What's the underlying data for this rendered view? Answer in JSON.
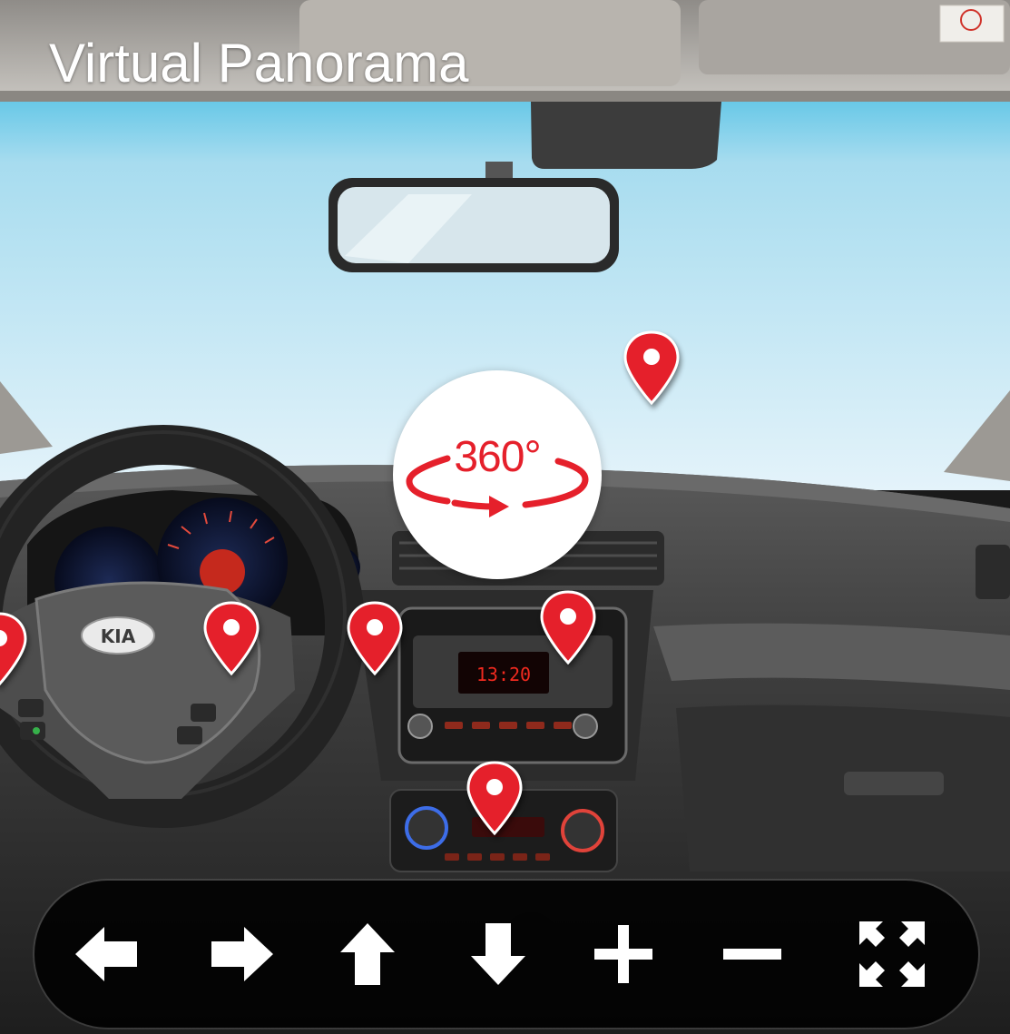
{
  "title": "Virtual Panorama",
  "badge": {
    "label": "360°",
    "icon": "rotate-360-icon",
    "color": "#e5202b"
  },
  "scene": {
    "brand_logo": "KIA",
    "radio_display": "13:20"
  },
  "hotspots": [
    {
      "name": "hotspot-windshield",
      "icon": "map-pin-icon"
    },
    {
      "name": "hotspot-steering-wheel-left",
      "icon": "map-pin-icon"
    },
    {
      "name": "hotspot-steering-wheel",
      "icon": "map-pin-icon"
    },
    {
      "name": "hotspot-dashboard-left",
      "icon": "map-pin-icon"
    },
    {
      "name": "hotspot-radio",
      "icon": "map-pin-icon"
    },
    {
      "name": "hotspot-climate-control",
      "icon": "map-pin-icon"
    }
  ],
  "controls": [
    {
      "name": "pan-left-button",
      "icon": "arrow-left-icon"
    },
    {
      "name": "pan-right-button",
      "icon": "arrow-right-icon"
    },
    {
      "name": "pan-up-button",
      "icon": "arrow-up-icon"
    },
    {
      "name": "pan-down-button",
      "icon": "arrow-down-icon"
    },
    {
      "name": "zoom-in-button",
      "icon": "plus-icon"
    },
    {
      "name": "zoom-out-button",
      "icon": "minus-icon"
    },
    {
      "name": "fullscreen-button",
      "icon": "fullscreen-icon"
    }
  ],
  "colors": {
    "pin": "#e5202b",
    "control_bar": "#000000",
    "control_icon": "#ffffff",
    "sky": "#bfe3f2"
  }
}
